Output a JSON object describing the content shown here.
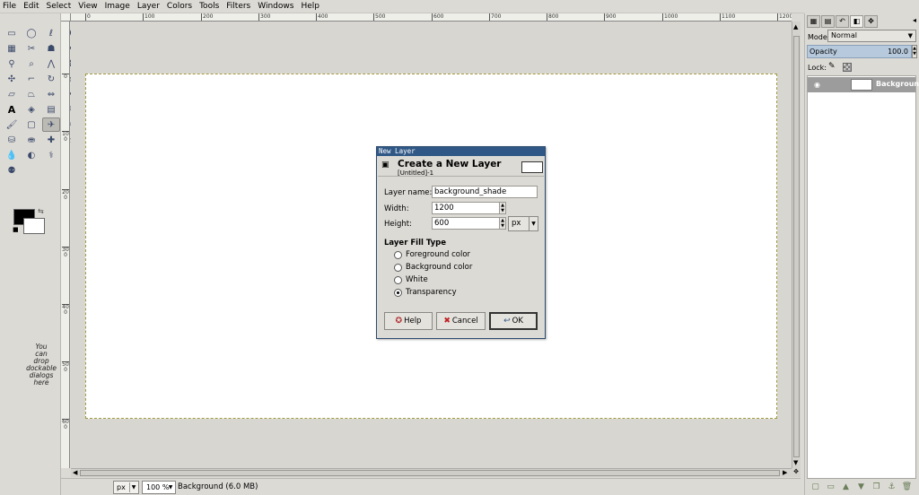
{
  "menubar": {
    "items": [
      "File",
      "Edit",
      "Select",
      "View",
      "Image",
      "Layer",
      "Colors",
      "Tools",
      "Filters",
      "Windows",
      "Help"
    ]
  },
  "toolbox": {
    "drop_hint": [
      "You",
      "can",
      "drop",
      "dockable",
      "dialogs",
      "here"
    ]
  },
  "rulers": {
    "top_ticks": [
      "0",
      "100",
      "200",
      "300",
      "400",
      "500",
      "600",
      "700",
      "800",
      "900",
      "1000",
      "1100",
      "1200"
    ],
    "left_ticks": [
      "0",
      "100",
      "200",
      "300",
      "400",
      "500",
      "600"
    ]
  },
  "statusbar": {
    "unit": "px",
    "zoom": "100 %",
    "status": "Background (6.0 MB)"
  },
  "dock": {
    "mode_label": "Mode:",
    "mode_value": "Normal",
    "opacity_label": "Opacity",
    "opacity_value": "100.0",
    "lock_label": "Lock:",
    "layers": [
      {
        "name": "Background"
      }
    ]
  },
  "dialog": {
    "window_title": "New Layer",
    "heading": "Create a New Layer",
    "subheading": "[Untitled]-1",
    "layer_name_label": "Layer name:",
    "layer_name_value": "background_shade",
    "width_label": "Width:",
    "width_value": "1200",
    "height_label": "Height:",
    "height_value": "600",
    "unit_value": "px",
    "fill_type_title": "Layer Fill Type",
    "fill_options": [
      "Foreground color",
      "Background color",
      "White",
      "Transparency"
    ],
    "selected_fill": "Transparency",
    "help_label": "Help",
    "cancel_label": "Cancel",
    "ok_label": "OK"
  },
  "colors": {
    "foreground": "#000000",
    "background": "#ffffff",
    "dialog_titlebar": "#2f5886",
    "selection": "#b7c9dc"
  }
}
